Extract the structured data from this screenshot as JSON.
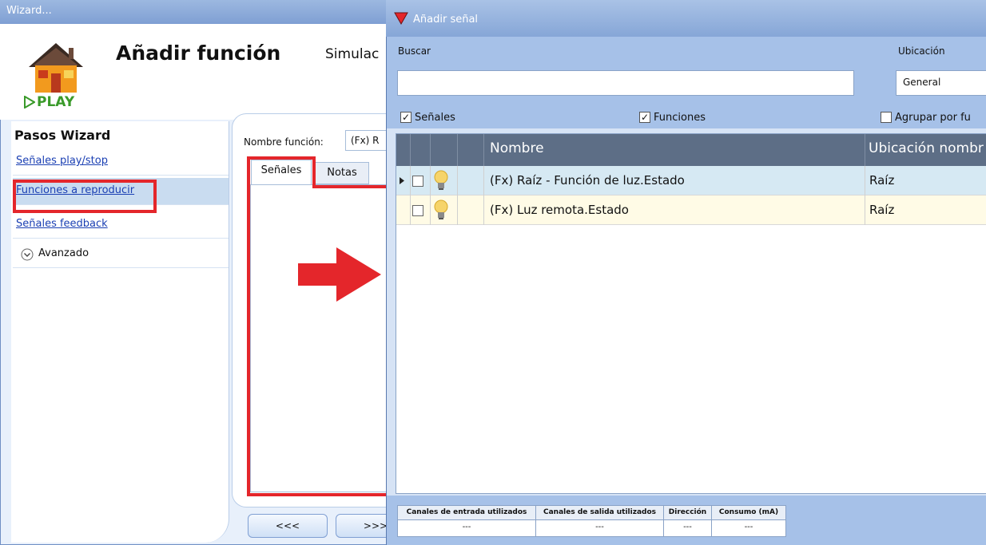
{
  "wizard": {
    "window_title": "Wizard...",
    "heading": "Añadir función",
    "sim_tab": "Simulac",
    "logo_text": "PLAY",
    "steps_title": "Pasos Wizard",
    "steps": [
      {
        "label": "Señales play/stop"
      },
      {
        "label": "Funciones a reproducir"
      },
      {
        "label": "Señales feedback"
      }
    ],
    "advanced_label": "Avanzado",
    "function_name_label": "Nombre función:",
    "function_name_value": "(Fx) R",
    "tabs": [
      "Señales",
      "Notas"
    ],
    "prev_button": "<<<",
    "next_button": ">>>"
  },
  "dialog": {
    "title": "Añadir señal",
    "search_label": "Buscar",
    "search_value": "",
    "location_label": "Ubicación",
    "location_value": "General",
    "checkboxes": {
      "signals": {
        "label": "Señales",
        "checked": true
      },
      "functions": {
        "label": "Funciones",
        "checked": true
      },
      "group": {
        "label": "Agrupar por fu",
        "checked": false
      }
    },
    "grid": {
      "columns": [
        "Nombre",
        "Ubicación nombr"
      ],
      "rows": [
        {
          "name": "(Fx) Raíz - Función de luz.Estado",
          "location": "Raíz",
          "checked": false,
          "icon": "lightbulb-icon"
        },
        {
          "name": "(Fx) Luz remota.Estado",
          "location": "Raíz",
          "checked": false,
          "icon": "lightbulb-icon"
        }
      ]
    },
    "stats": {
      "headers": [
        "Canales de entrada utilizados",
        "Canales de salida utilizados",
        "Dirección",
        "Consumo (mA)"
      ],
      "values": [
        "---",
        "---",
        "---",
        "---"
      ]
    }
  },
  "colors": {
    "highlight": "#e4262b",
    "grid_header": "#5d6e86",
    "selected_row": "#d6e9f3",
    "alt_row": "#fffbe6"
  }
}
